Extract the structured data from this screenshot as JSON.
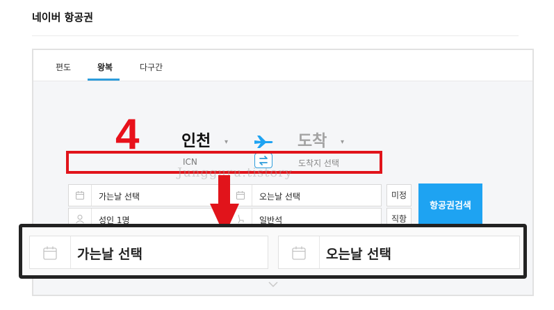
{
  "page": {
    "title": "네이버 항공권"
  },
  "tabs": [
    {
      "label": "편도",
      "active": false
    },
    {
      "label": "왕복",
      "active": true
    },
    {
      "label": "다구간",
      "active": false
    }
  ],
  "annotation": {
    "step_number": "4",
    "watermark": "Jungguru.tistory"
  },
  "departure": {
    "city": "인천",
    "code": "ICN",
    "caret": "▾"
  },
  "arrival": {
    "city": "도착",
    "sub": "도착지 선택",
    "caret": "▾"
  },
  "fields": {
    "go_date": "가는날 선택",
    "return_date": "오는날 선택",
    "passengers": "성인 1명",
    "seat_class": "일반석"
  },
  "toggles": {
    "undecided": "미정",
    "direct": "직항"
  },
  "search": {
    "label": "항공권검색"
  },
  "zoom": {
    "go_date": "가는날 선택",
    "return_date": "오는날 선택"
  },
  "colors": {
    "accent": "#1ea3f2",
    "highlight": "#e1141b",
    "frame": "#222222"
  },
  "icons": [
    "calendar-icon",
    "person-icon",
    "seat-icon",
    "plane-icon",
    "swap-icon",
    "chevron-down-icon"
  ]
}
